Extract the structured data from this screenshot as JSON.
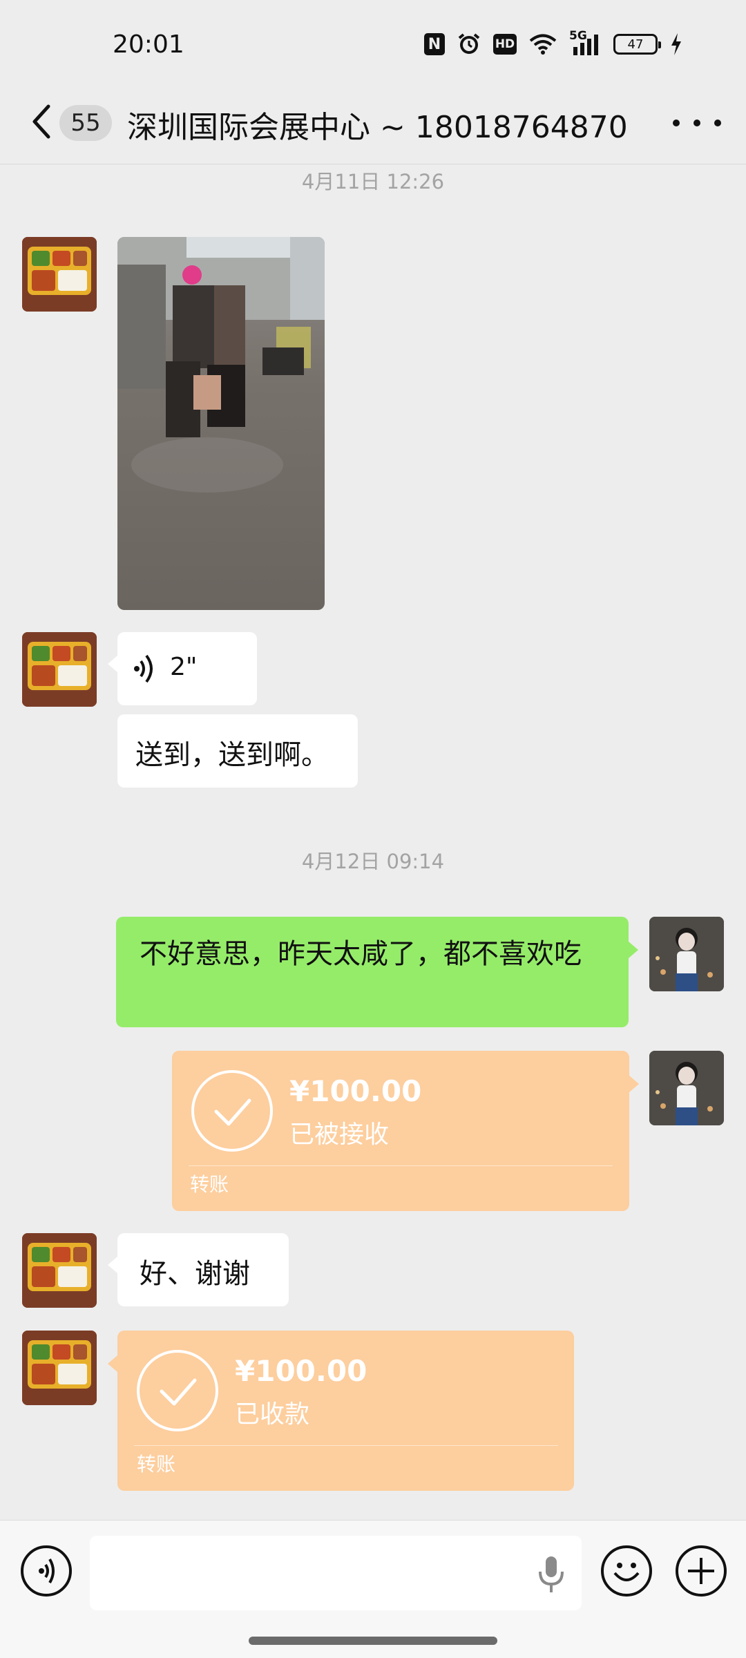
{
  "status_bar": {
    "time": "20:01",
    "nfc_label": "N",
    "hd_label": "HD",
    "network_label": "5G",
    "battery_level": "47",
    "icons": [
      "nfc-icon",
      "alarm-icon",
      "hd-icon",
      "wifi-icon",
      "signal-5g-icon",
      "battery-icon",
      "charging-icon"
    ]
  },
  "header": {
    "unread_count": "55",
    "title": "深圳国际会展中心 ~ 18018764870"
  },
  "messages": {
    "ts1": "4月11日 12:26",
    "voice_duration": "2\"",
    "text1": "送到，送到啊。",
    "ts2": "4月12日 09:14",
    "sent_text": "不好意思，昨天太咸了，都不喜欢吃",
    "transfer1": {
      "amount": "¥100.00",
      "status": "已被接收",
      "label": "转账"
    },
    "reply_text": "好、谢谢",
    "transfer2": {
      "amount": "¥100.00",
      "status": "已收款",
      "label": "转账"
    }
  },
  "input": {
    "placeholder": ""
  },
  "colors": {
    "background": "#ededed",
    "sent_bubble": "#95ec69",
    "transfer_bubble": "#fdce9e"
  }
}
